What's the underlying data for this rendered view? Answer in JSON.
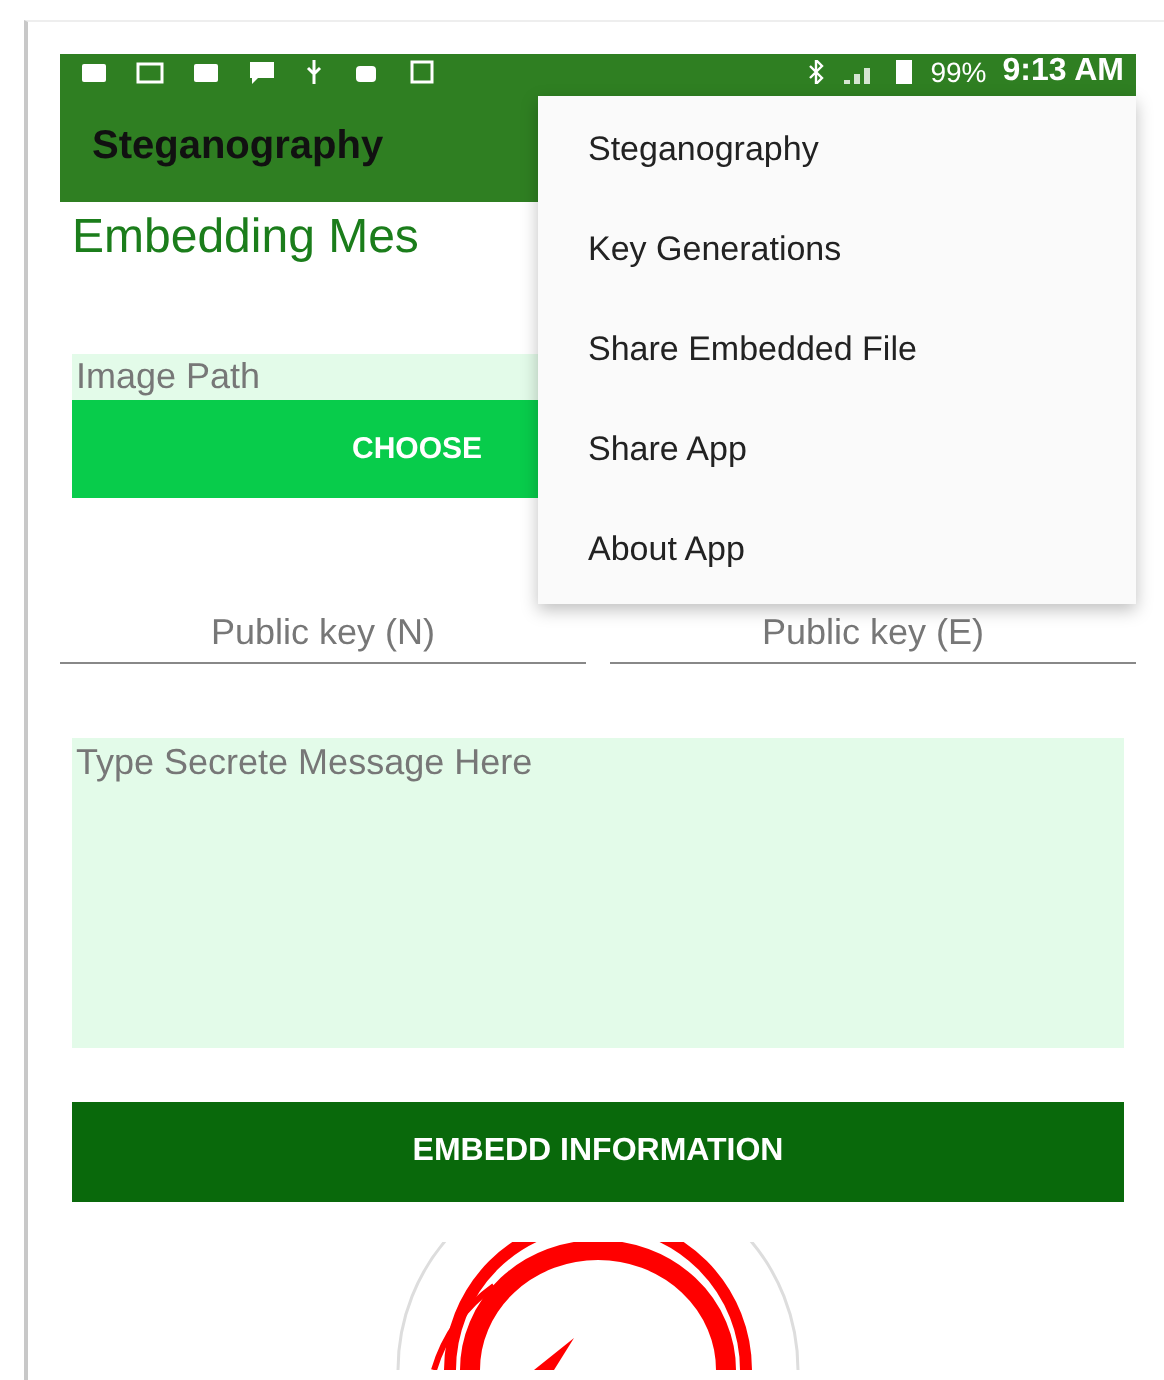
{
  "status_bar": {
    "battery": "99%",
    "time": "9:13 AM"
  },
  "toolbar": {
    "title": "Steganography"
  },
  "menu": {
    "items": [
      "Steganography",
      "Key Generations",
      "Share Embedded File",
      "Share App",
      "About App"
    ]
  },
  "heading": "Embedding Mes",
  "image_path": {
    "placeholder": "Image Path"
  },
  "choose_button": "CHOOSE",
  "key_fields": [
    {
      "placeholder": "Public key (N)"
    },
    {
      "placeholder": "Public key (E)"
    }
  ],
  "message": {
    "placeholder": "Type Secrete Message Here"
  },
  "embed_button": "EMBEDD INFORMATION"
}
